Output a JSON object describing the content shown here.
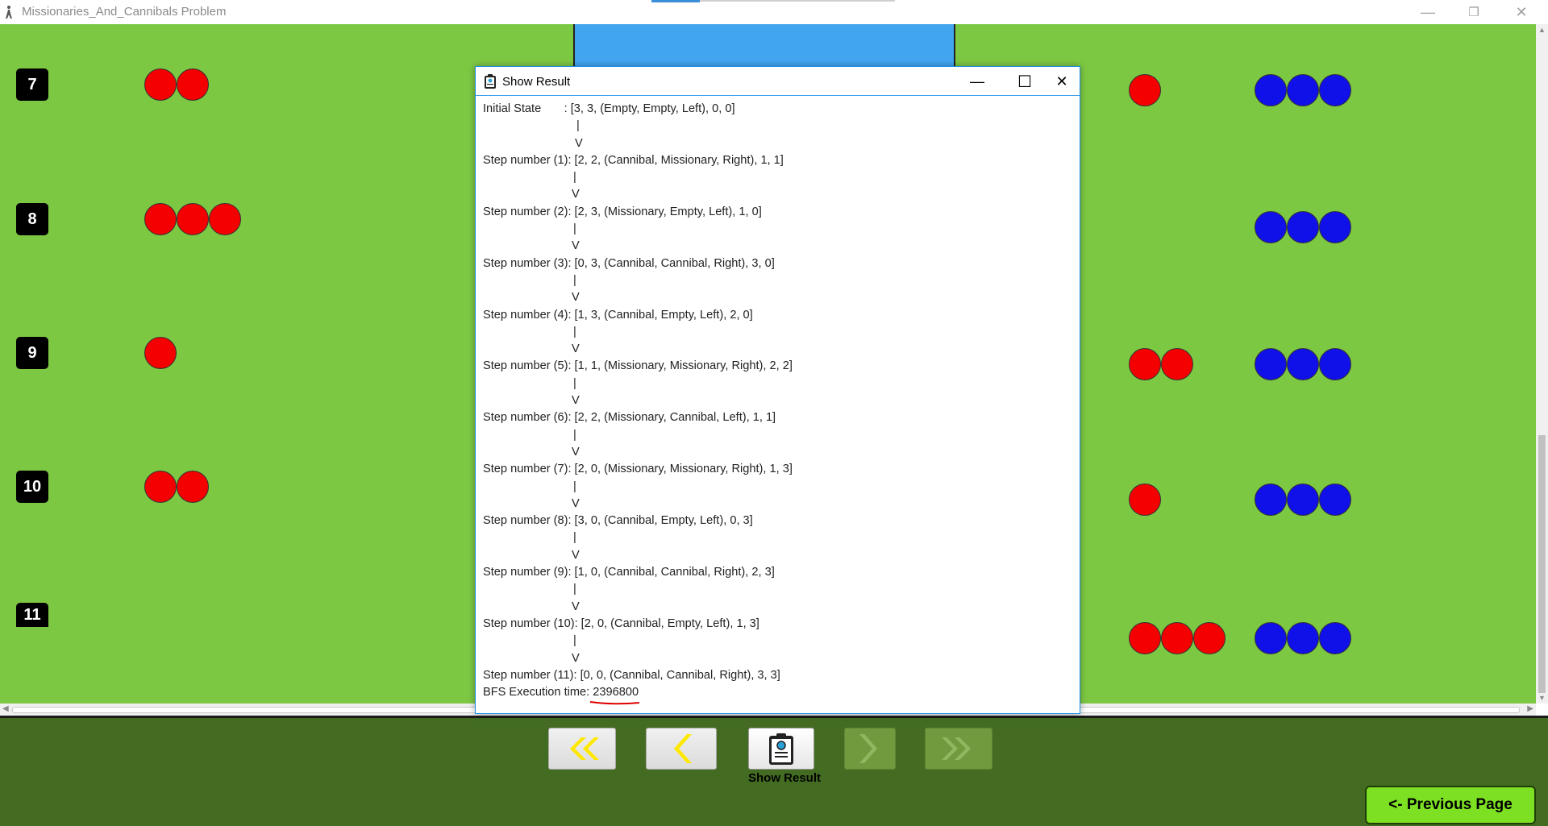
{
  "window": {
    "title": "Missionaries_And_Cannibals Problem",
    "minimize": "—",
    "restore": "❐",
    "close": "✕"
  },
  "game": {
    "rows": [
      {
        "num": "7",
        "left_red": 2,
        "right_red": 1,
        "right_blue": 3
      },
      {
        "num": "8",
        "left_red": 3,
        "right_red": 0,
        "right_blue": 3
      },
      {
        "num": "9",
        "left_red": 1,
        "right_red": 2,
        "right_blue": 3
      },
      {
        "num": "10",
        "left_red": 2,
        "right_red": 1,
        "right_blue": 3
      },
      {
        "num": "11",
        "left_red": 0,
        "right_red": 3,
        "right_blue": 3
      }
    ],
    "colors": {
      "grass": "#7dc843",
      "river": "#42a5f0",
      "cannibal": "#f40000",
      "missionary": "#1010e8"
    }
  },
  "dialog": {
    "title": "Show Result",
    "minimize": "—",
    "maximize": "☐",
    "close": "✕",
    "states": [
      {
        "label": "Initial State       : [3, 3, (Empty, Empty, Left), 0, 0]"
      },
      {
        "label": "Step number (1): [2, 2, (Cannibal, Missionary, Right), 1, 1]"
      },
      {
        "label": "Step number (2): [2, 3, (Missionary, Empty, Left), 1, 0]"
      },
      {
        "label": "Step number (3): [0, 3, (Cannibal, Cannibal, Right), 3, 0]"
      },
      {
        "label": "Step number (4): [1, 3, (Cannibal, Empty, Left), 2, 0]"
      },
      {
        "label": "Step number (5): [1, 1, (Missionary, Missionary, Right), 2, 2]"
      },
      {
        "label": "Step number (6): [2, 2, (Missionary, Cannibal, Left), 1, 1]"
      },
      {
        "label": "Step number (7): [2, 0, (Missionary, Missionary, Right), 1, 3]"
      },
      {
        "label": "Step number (8): [3, 0, (Cannibal, Empty, Left), 0, 3]"
      },
      {
        "label": "Step number (9): [1, 0, (Cannibal, Cannibal, Right), 2, 3]"
      },
      {
        "label": "Step number (10): [2, 0, (Cannibal, Empty, Left), 1, 3]"
      },
      {
        "label": "Step number (11): [0, 0, (Cannibal, Cannibal, Right), 3, 3]"
      }
    ],
    "connector_bar": "|",
    "connector_arrow": "V",
    "exec_label": "BFS Execution time: ",
    "exec_value": "2396800"
  },
  "bottom": {
    "first_icon": "«",
    "prev_icon": "‹",
    "next_icon": "›",
    "last_icon": "»",
    "show_result_label": "Show Result",
    "previous_page_label": "<- Previous Page"
  }
}
